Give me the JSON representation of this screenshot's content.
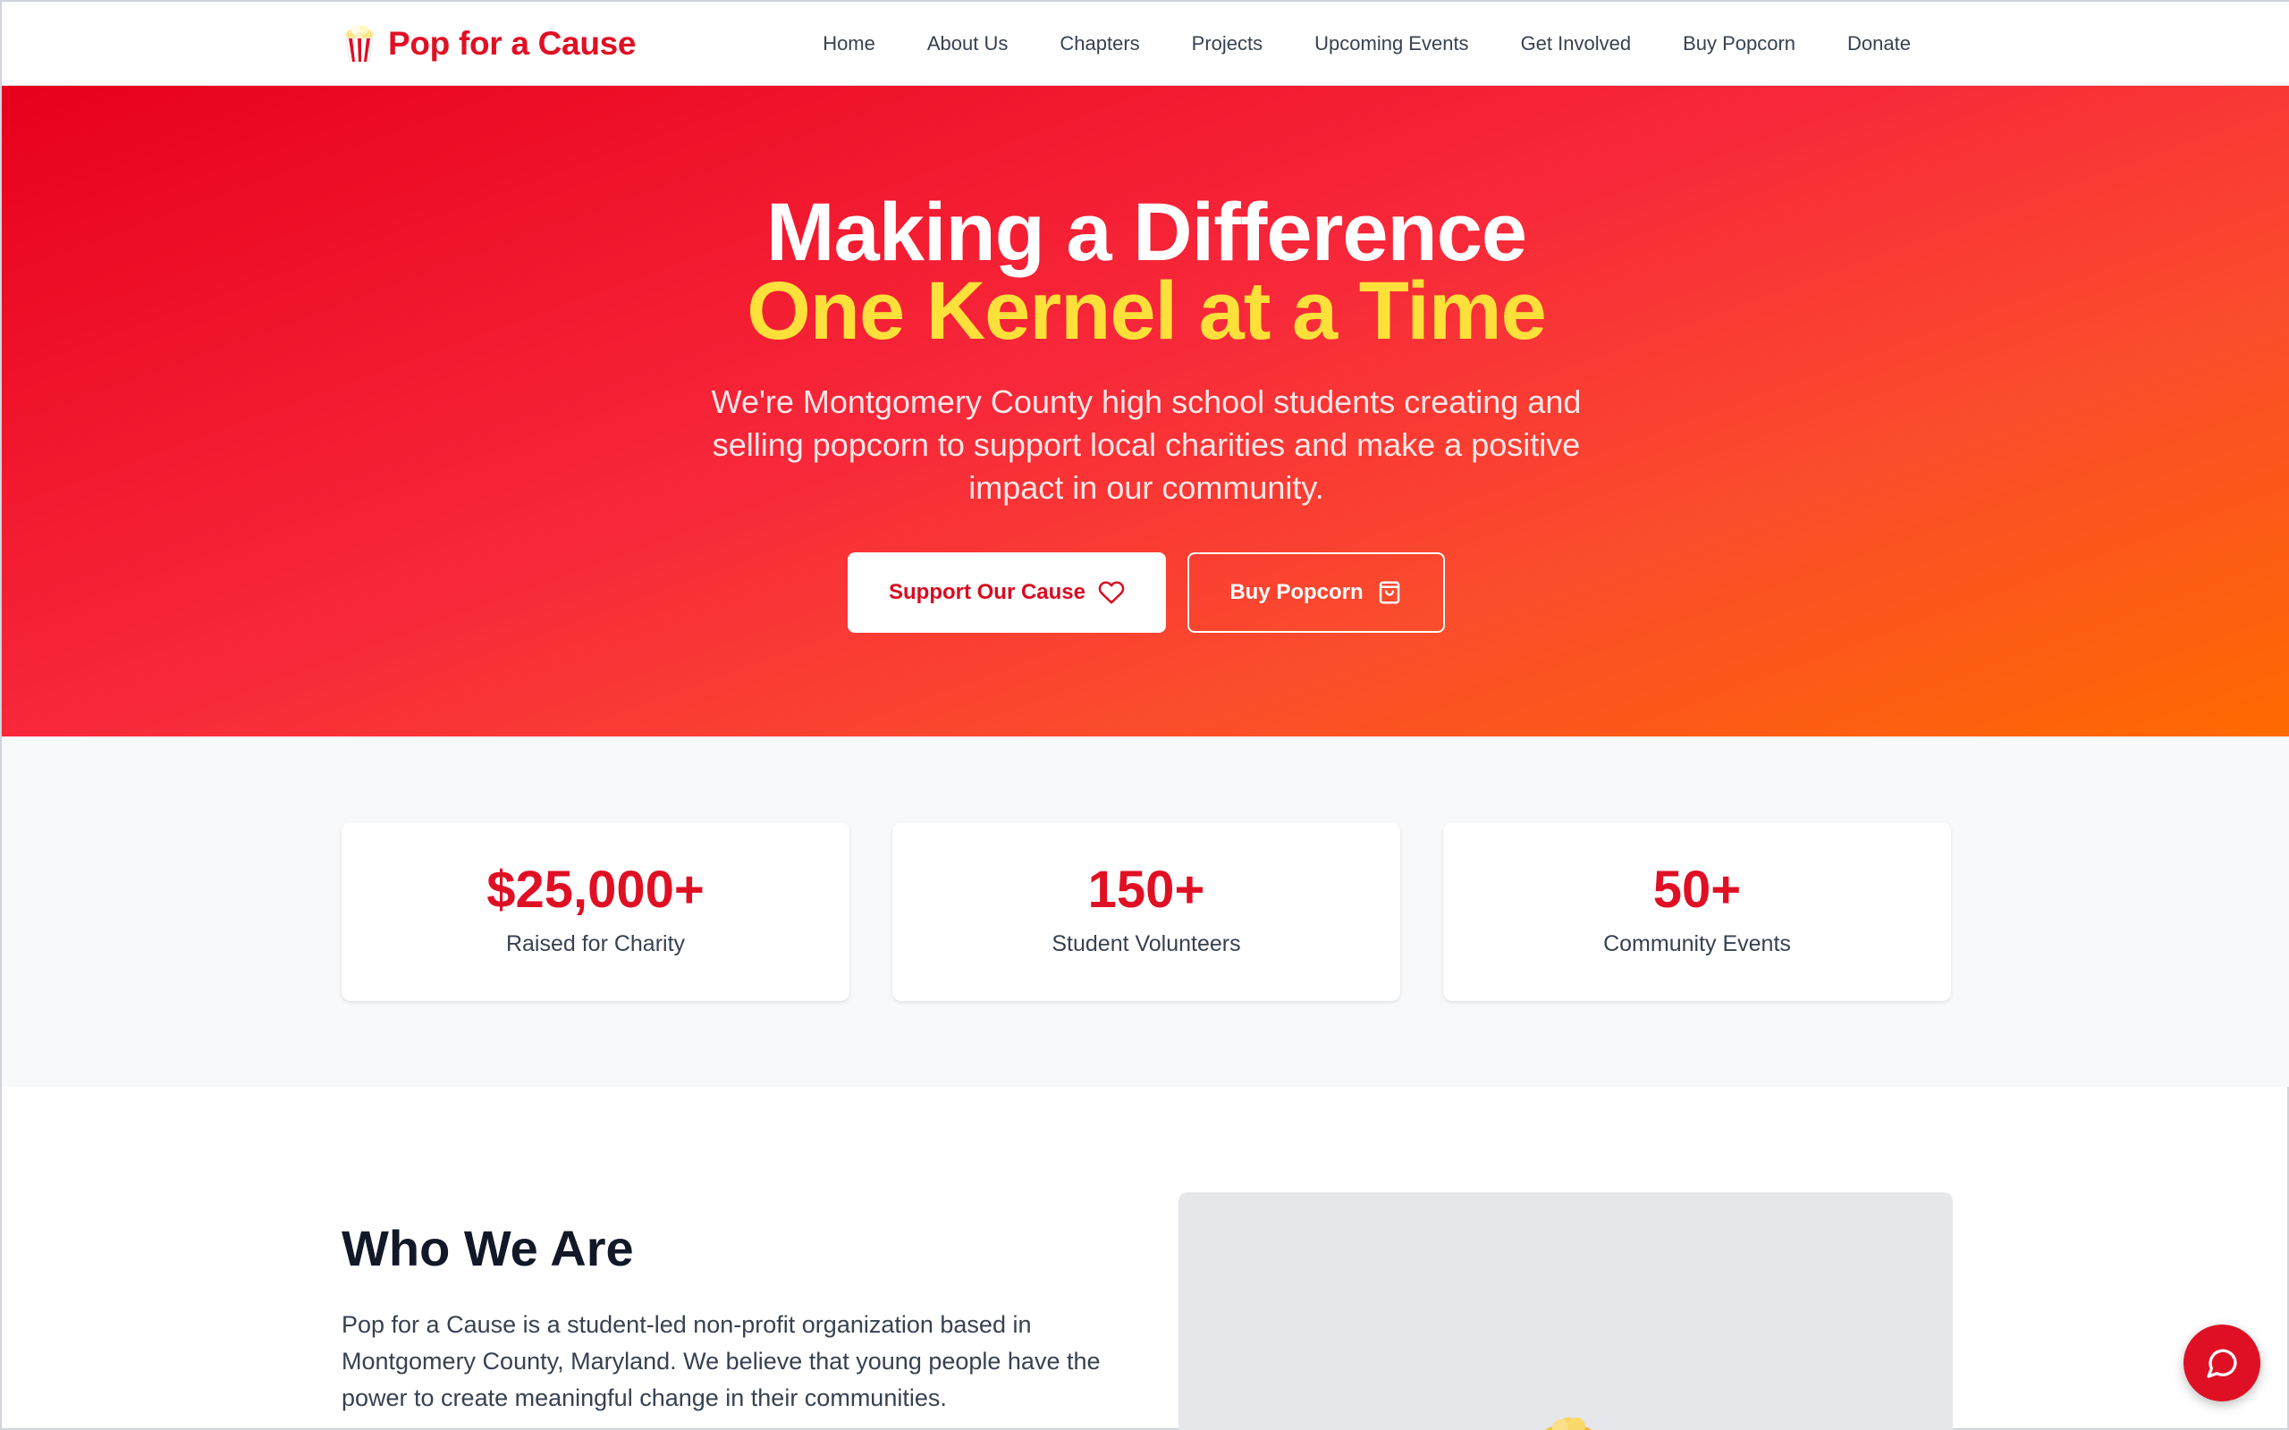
{
  "brand": {
    "name": "Pop for a Cause",
    "icon": "popcorn-icon",
    "color": "#e01024"
  },
  "nav": {
    "items": [
      {
        "label": "Home"
      },
      {
        "label": "About Us"
      },
      {
        "label": "Chapters"
      },
      {
        "label": "Projects"
      },
      {
        "label": "Upcoming Events"
      },
      {
        "label": "Get Involved"
      },
      {
        "label": "Buy Popcorn"
      },
      {
        "label": "Donate"
      }
    ]
  },
  "hero": {
    "title_line1": "Making a Difference",
    "title_line2": "One Kernel at a Time",
    "subtitle": "We're Montgomery County high school students creating and selling popcorn to support local charities and make a positive impact in our community.",
    "primary_button": {
      "label": "Support Our Cause",
      "icon": "heart-icon"
    },
    "secondary_button": {
      "label": "Buy Popcorn",
      "icon": "shopping-bag-icon"
    },
    "gradient_start": "#e8001c",
    "gradient_end": "#ff6a00",
    "accent_color": "#fde03a"
  },
  "stats": [
    {
      "value": "$25,000+",
      "label": "Raised for Charity"
    },
    {
      "value": "150+",
      "label": "Student Volunteers"
    },
    {
      "value": "50+",
      "label": "Community Events"
    }
  ],
  "who": {
    "title": "Who We Are",
    "text": "Pop for a Cause is a student-led non-profit organization based in Montgomery County, Maryland. We believe that young people have the power to create meaningful change in their communities."
  },
  "chat": {
    "icon": "chat-bubble-icon"
  }
}
